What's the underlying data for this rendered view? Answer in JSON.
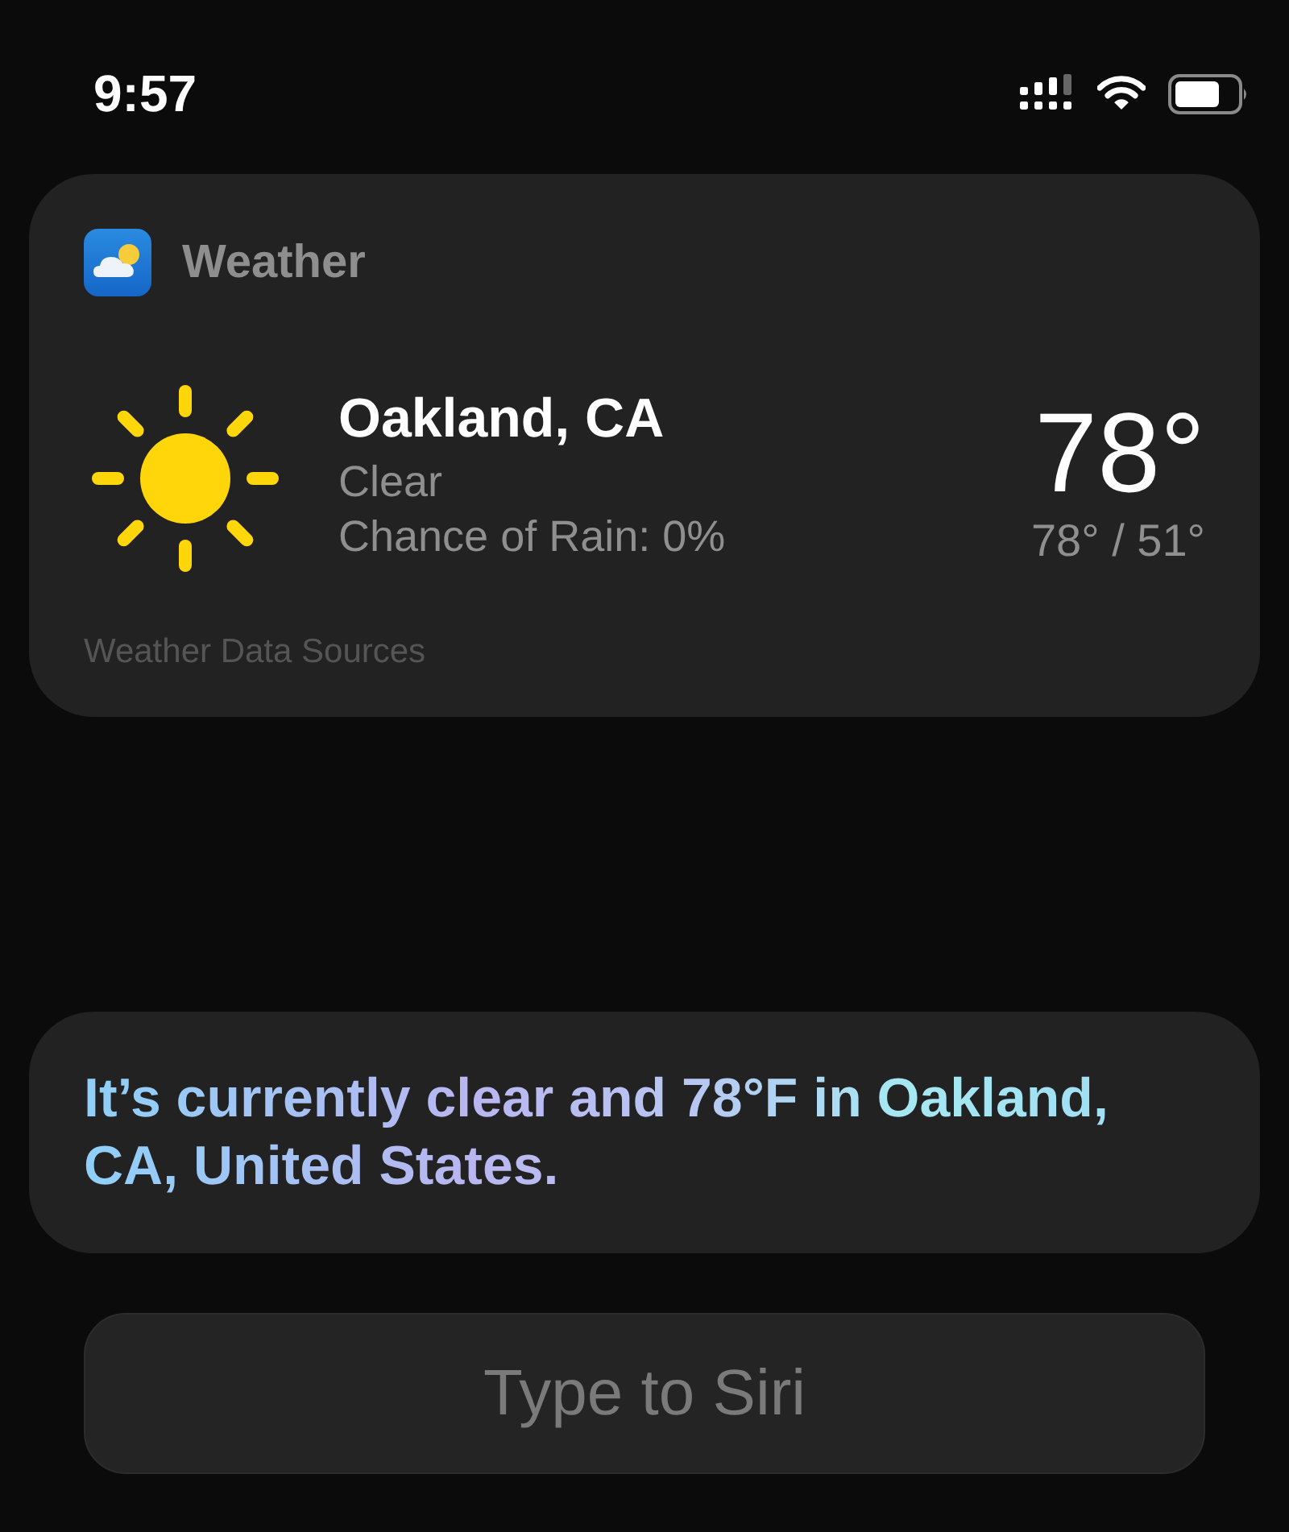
{
  "status_bar": {
    "time": "9:57"
  },
  "weather_card": {
    "app_name": "Weather",
    "city": "Oakland, CA",
    "condition": "Clear",
    "rain_chance": "Chance of Rain: 0%",
    "temperature": "78°",
    "high_low": "78° / 51°",
    "footer": "Weather Data Sources"
  },
  "siri_response": {
    "text": "It’s currently clear and 78°F in Oakland, CA, United States."
  },
  "input": {
    "placeholder": "Type to Siri"
  }
}
